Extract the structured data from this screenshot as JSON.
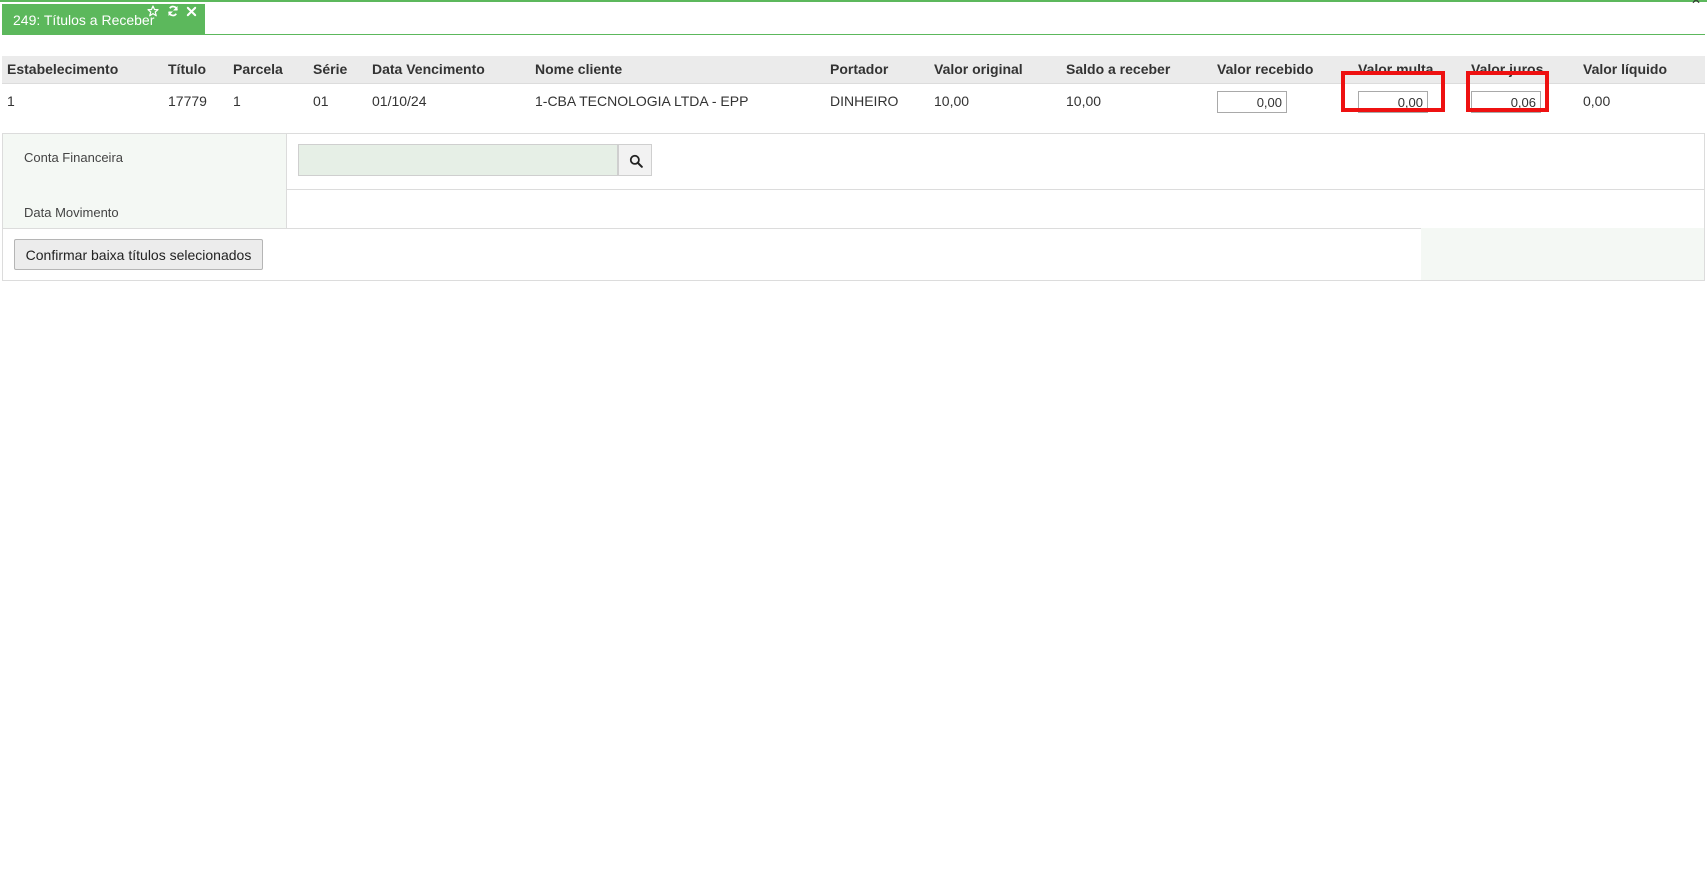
{
  "window": {
    "tab_title": "249: Títulos a Receber"
  },
  "icons": {
    "star": "star-icon",
    "refresh": "refresh-icon",
    "close": "close-icon",
    "search": "search-icon"
  },
  "colors": {
    "accent": "#5cb85c",
    "highlight": "#ee1111",
    "header_bg": "#ebebeb",
    "label_bg": "#f4f8f4",
    "lookup_bg": "#e6efe6"
  },
  "table": {
    "headers": {
      "estabelecimento": "Estabelecimento",
      "titulo": "Título",
      "parcela": "Parcela",
      "serie": "Série",
      "data_vencimento": "Data Vencimento",
      "nome_cliente": "Nome cliente",
      "portador": "Portador",
      "valor_original": "Valor original",
      "saldo_receber": "Saldo a receber",
      "valor_recebido": "Valor recebido",
      "valor_multa": "Valor multa",
      "valor_juros": "Valor juros",
      "valor_liquido": "Valor líquido"
    },
    "rows": [
      {
        "estabelecimento": "1",
        "titulo": "17779",
        "parcela": "1",
        "serie": "01",
        "data_vencimento": "01/10/24",
        "nome_cliente": "1-CBA TECNOLOGIA LTDA - EPP",
        "portador": "DINHEIRO",
        "valor_original": "10,00",
        "saldo_receber": "10,00",
        "valor_recebido": "0,00",
        "valor_multa": "0,00",
        "valor_juros": "0,06",
        "valor_liquido": "0,00"
      }
    ]
  },
  "form": {
    "conta_financeira_label": "Conta Financeira",
    "conta_financeira_value": "",
    "data_movimento_label": "Data Movimento",
    "confirm_button": "Confirmar baixa títulos selecionados"
  }
}
